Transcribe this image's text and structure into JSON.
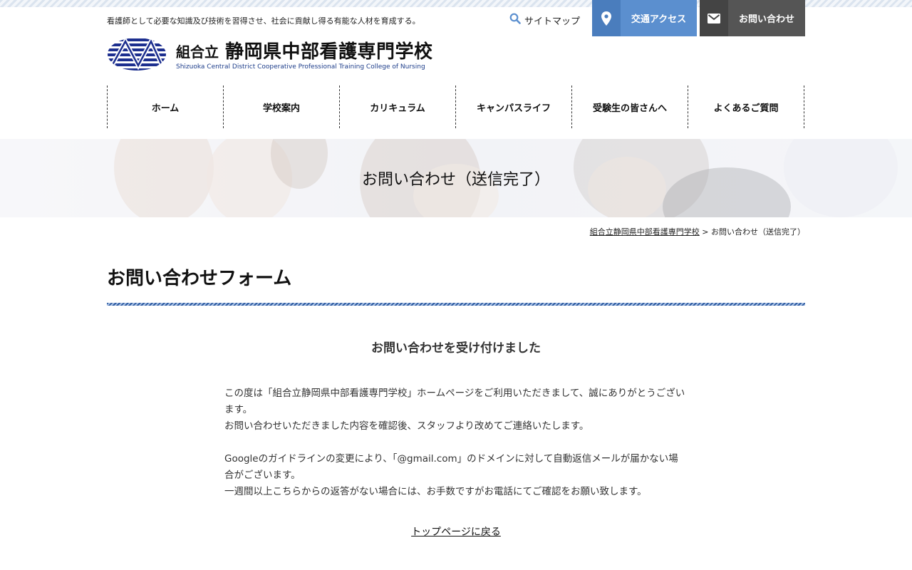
{
  "header": {
    "tagline": "看護師として必要な知識及び技術を習得させ、社会に貢献し得る有能な人材を育成する。",
    "sitemap_label": "サイトマップ",
    "access_label": "交通アクセス",
    "contact_label": "お問い合わせ",
    "logo": {
      "prefix": "組合立",
      "name": "静岡県中部看護専門学校",
      "english": "Shizuoka Central District Cooperative Professional Training College of Nursing"
    }
  },
  "nav": {
    "items": [
      {
        "label": "ホーム"
      },
      {
        "label": "学校案内"
      },
      {
        "label": "カリキュラム"
      },
      {
        "label": "キャンパスライフ"
      },
      {
        "label": "受験生の皆さんへ"
      },
      {
        "label": "よくあるご質問"
      }
    ]
  },
  "hero": {
    "title": "お問い合わせ（送信完了）"
  },
  "breadcrumb": {
    "home_link": "組合立静岡県中部看護専門学校",
    "separator": ">",
    "current": "お問い合わせ（送信完了）"
  },
  "main": {
    "heading": "お問い合わせフォーム",
    "done_title": "お問い合わせを受け付けました",
    "paragraph1": "この度は「組合立静岡県中部看護専門学校」ホームページをご利用いただきまして、誠にありがとうございます。",
    "paragraph2": "お問い合わせいただきました内容を確認後、スタッフより改めてご連絡いたします。",
    "paragraph3": "Googleのガイドラインの変更により、「@gmail.com」のドメインに対して自動返信メールが届かない場合がございます。",
    "paragraph4": "一週間以上こちらからの返答がない場合には、お手数ですがお電話にてご確認をお願い致します。",
    "back_link": "トップページに戻る"
  },
  "colors": {
    "access_button": "#5b8fcf",
    "contact_button": "#555555",
    "logo_navy": "#1d3d8a",
    "rule_blue": "#2f5da3"
  },
  "icons": {
    "sitemap": "search-icon",
    "access": "map-pin-icon",
    "contact": "envelope-icon"
  }
}
